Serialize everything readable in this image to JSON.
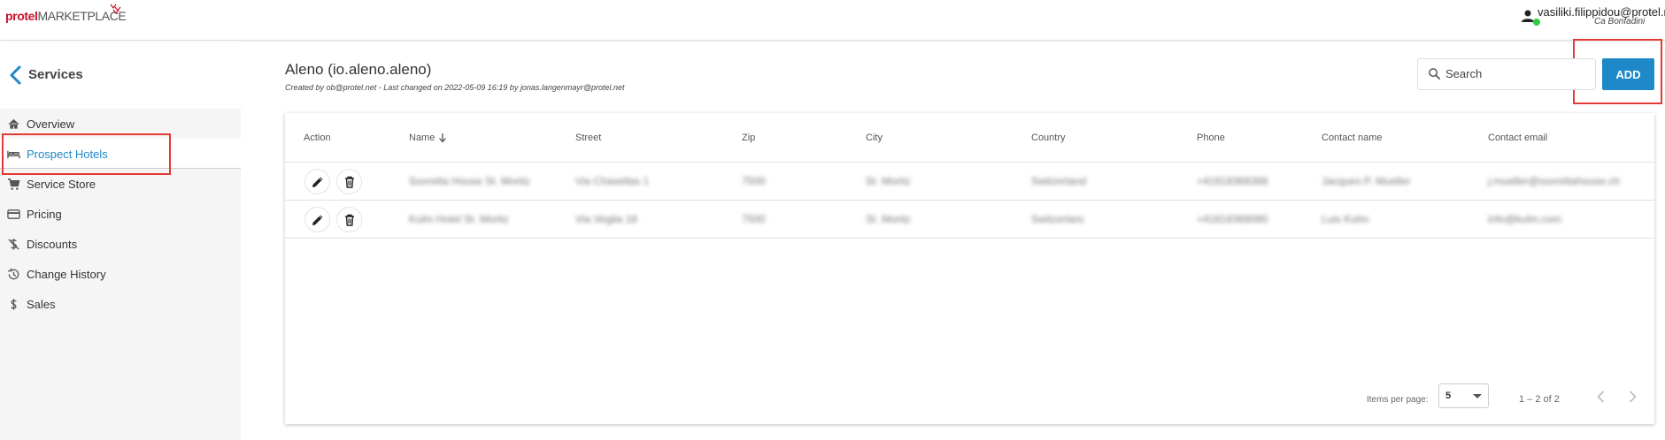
{
  "topbar": {
    "logo_brand": "protel",
    "logo_name": "MARKETPLACE",
    "user_email": "vasiliki.filippidou@protel.n",
    "user_property": "Ca Bonfadini"
  },
  "sidebar": {
    "title": "Services",
    "items": [
      {
        "label": "Overview",
        "icon": "home-icon"
      },
      {
        "label": "Prospect Hotels",
        "icon": "bed-icon",
        "active": true
      },
      {
        "label": "Service Store",
        "icon": "cart-icon"
      },
      {
        "label": "Pricing",
        "icon": "credit-card-icon"
      },
      {
        "label": "Discounts",
        "icon": "discount-icon"
      },
      {
        "label": "Change History",
        "icon": "history-icon"
      },
      {
        "label": "Sales",
        "icon": "dollar-icon"
      }
    ]
  },
  "header": {
    "title": "Aleno (io.aleno.aleno)",
    "subtitle": "Created by ob@protel.net - Last changed on 2022-05-09 16:19 by jonas.langenmayr@protel.net",
    "search_placeholder": "Search",
    "add_label": "ADD"
  },
  "table": {
    "columns": [
      "Action",
      "Name",
      "Street",
      "Zip",
      "City",
      "Country",
      "Phone",
      "Contact name",
      "Contact email"
    ],
    "rows": [
      {
        "name": "Suvretta House St. Moritz",
        "street": "Via Chasellas 1",
        "zip": "7500",
        "city": "St. Moritz",
        "country": "Switzerland",
        "phone": "+41818368368",
        "contact_name": "Jacques P. Mueller",
        "contact_email": "j.mueller@suvrettahouse.ch"
      },
      {
        "name": "Kulm Hotel St. Moritz",
        "street": "Via Veglia 18",
        "zip": "7500",
        "city": "St. Moritz",
        "country": "Switzerland",
        "phone": "+41818368080",
        "contact_name": "Luis Kuhn",
        "contact_email": "info@kulm.com"
      }
    ]
  },
  "paginator": {
    "items_per_page_label": "Items per page:",
    "page_size": "5",
    "range": "1 – 2 of 2"
  },
  "colors": {
    "accent": "#1e88c9",
    "brand": "#c8102e",
    "highlight_box": "#e53935",
    "online_status": "#2ecc40"
  }
}
